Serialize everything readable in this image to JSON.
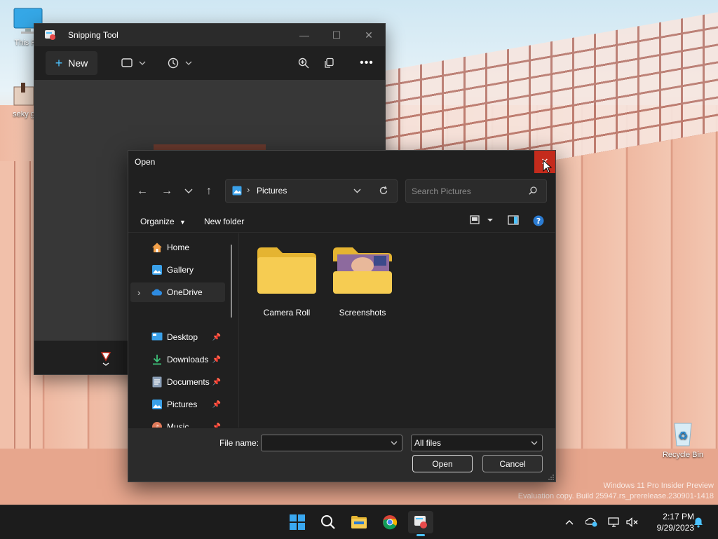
{
  "desktop": {
    "icons": [
      {
        "label": "This PC"
      },
      {
        "label": "seky g"
      },
      {
        "label": "Recycle Bin"
      }
    ],
    "watermark": {
      "line1": "Windows 11 Pro Insider Preview",
      "line2": "Evaluation copy. Build 25947.rs_prerelease.230901-1418"
    }
  },
  "snipping_tool": {
    "title": "Snipping Tool",
    "new_label": "New",
    "icons": [
      "snip-mode-icon",
      "delay-icon",
      "zoom-icon",
      "copy-icon",
      "more-icon"
    ]
  },
  "open_dialog": {
    "title": "Open",
    "address": {
      "location": "Pictures"
    },
    "search": {
      "placeholder": "Search Pictures"
    },
    "commands": {
      "organize": "Organize",
      "new_folder": "New folder"
    },
    "nav": [
      {
        "label": "Home",
        "icon": "home-icon",
        "pinned": false
      },
      {
        "label": "Gallery",
        "icon": "gallery-icon",
        "pinned": false
      },
      {
        "label": "OneDrive",
        "icon": "onedrive-icon",
        "pinned": false,
        "selected": true
      },
      {
        "label": "Desktop",
        "icon": "desktop-icon",
        "pinned": true
      },
      {
        "label": "Downloads",
        "icon": "downloads-icon",
        "pinned": true
      },
      {
        "label": "Documents",
        "icon": "documents-icon",
        "pinned": true
      },
      {
        "label": "Pictures",
        "icon": "pictures-icon",
        "pinned": true
      },
      {
        "label": "Music",
        "icon": "music-icon",
        "pinned": true
      }
    ],
    "folders": [
      {
        "label": "Camera Roll"
      },
      {
        "label": "Screenshots"
      }
    ],
    "footer": {
      "file_name_label": "File name:",
      "file_name_value": "",
      "file_type": "All files",
      "open": "Open",
      "cancel": "Cancel"
    }
  },
  "taskbar": {
    "apps": [
      "start-icon",
      "search-icon",
      "file-explorer-icon",
      "chrome-icon",
      "snipping-tool-icon"
    ],
    "clock": {
      "time": "2:17 PM",
      "date": "9/29/2023"
    }
  },
  "colors": {
    "accent": "#4cc2ff",
    "close_red": "#c42b1c",
    "folder_yellow": "#f6cc52"
  }
}
